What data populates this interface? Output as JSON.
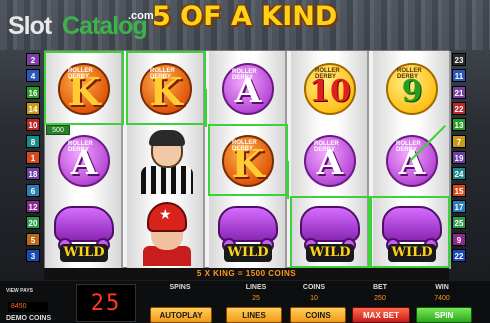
{
  "logo": {
    "slot": "Slot",
    "catalog": "Catalog",
    "com": ".com"
  },
  "win_banner": "5 OF A KIND",
  "symbol_text": {
    "roller_derby": "ROLLER DERBY",
    "k": "K",
    "a": "A",
    "ten": "10",
    "nine": "9",
    "wild": "WILD"
  },
  "win_tag": "500",
  "paylines_left": [
    "2",
    "4",
    "16",
    "14",
    "10",
    "8",
    "1",
    "18",
    "6",
    "12",
    "20",
    "5",
    "3"
  ],
  "paylines_right": [
    "23",
    "11",
    "21",
    "22",
    "13",
    "7",
    "19",
    "24",
    "15",
    "17",
    "25",
    "9",
    "22"
  ],
  "win_message": "5 X KING = 1500 COINS",
  "panel": {
    "view_pays": "VIEW PAYS",
    "credits": "8450",
    "demo": "DEMO COINS",
    "led": "25",
    "labels": [
      "SPINS",
      "LINES",
      "COINS",
      "BET",
      "WIN"
    ],
    "values": [
      "",
      "25",
      "10",
      "250",
      "7400"
    ],
    "buttons": [
      "AUTOPLAY",
      "LINES",
      "COINS",
      "MAX BET",
      "SPIN"
    ]
  },
  "colors": {
    "highlight": "#3ad13a",
    "win_text": "#ff9a1a",
    "title": "#ffd21a"
  }
}
